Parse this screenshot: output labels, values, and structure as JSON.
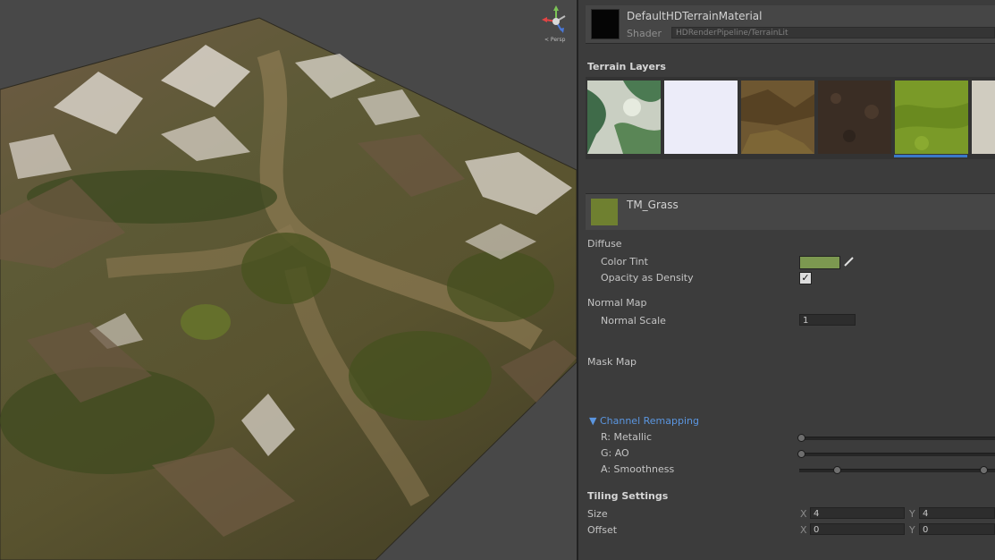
{
  "scene": {
    "gizmo_label": "< Persp"
  },
  "material": {
    "name": "DefaultHDTerrainMaterial",
    "shader_label": "Shader",
    "shader_value": "HDRenderPipeline/TerrainLit"
  },
  "terrain_layers": {
    "title": "Terrain Layers",
    "thumbnails": [
      "snow-rock",
      "blank-white",
      "dirt",
      "dark-soil",
      "grass",
      "pale-rock"
    ],
    "selected_index": 4
  },
  "layer": {
    "name": "TM_Grass",
    "diffuse": {
      "title": "Diffuse",
      "color_tint_label": "Color Tint",
      "color_tint": "#7c9850",
      "opacity_label": "Opacity as Density",
      "opacity_checked": true
    },
    "normal_map": {
      "title": "Normal Map",
      "normal_scale_label": "Normal Scale",
      "normal_scale": "1"
    },
    "mask_map": {
      "title": "Mask Map"
    },
    "channel_remapping": {
      "title": "Channel Remapping",
      "r_label": "R: Metallic",
      "g_label": "G: AO",
      "a_label": "A: Smoothness"
    },
    "tiling": {
      "title": "Tiling Settings",
      "size_label": "Size",
      "offset_label": "Offset",
      "x_label": "X",
      "y_label": "Y",
      "size_x": "4",
      "size_y": "4",
      "offset_x": "0",
      "offset_y": "0"
    }
  }
}
